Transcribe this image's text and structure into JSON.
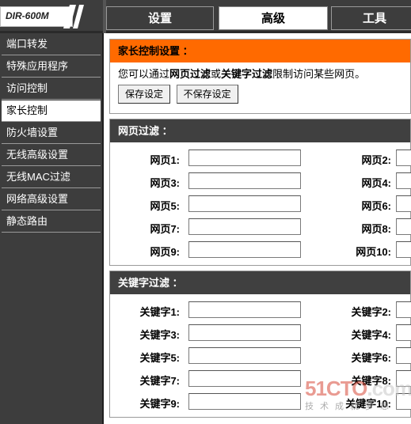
{
  "header": {
    "logo_text": "DIR-600M",
    "tabs": [
      {
        "label": "设置"
      },
      {
        "label": "高级"
      },
      {
        "label": "工具"
      }
    ]
  },
  "sidebar": {
    "items": [
      {
        "label": "端口转发"
      },
      {
        "label": "特殊应用程序"
      },
      {
        "label": "访问控制"
      },
      {
        "label": "家长控制"
      },
      {
        "label": "防火墙设置"
      },
      {
        "label": "无线高级设置"
      },
      {
        "label": "无线MAC过滤"
      },
      {
        "label": "网络高级设置"
      },
      {
        "label": "静态路由"
      }
    ]
  },
  "parental": {
    "title": "家长控制设置 ：",
    "intro_prefix": "您可以通过",
    "intro_bold1": "网页过滤",
    "intro_mid": "或",
    "intro_bold2": "关键字过滤",
    "intro_suffix": "限制访问某些网页。",
    "save_label": "保存设定",
    "nosave_label": "不保存设定"
  },
  "web_filter": {
    "title": "网页过滤 ：",
    "left": [
      {
        "label": "网页1:",
        "value": ""
      },
      {
        "label": "网页3:",
        "value": ""
      },
      {
        "label": "网页5:",
        "value": ""
      },
      {
        "label": "网页7:",
        "value": ""
      },
      {
        "label": "网页9:",
        "value": ""
      }
    ],
    "right": [
      {
        "label": "网页2:",
        "value": ""
      },
      {
        "label": "网页4:",
        "value": ""
      },
      {
        "label": "网页6:",
        "value": ""
      },
      {
        "label": "网页8:",
        "value": ""
      },
      {
        "label": "网页10:",
        "value": ""
      }
    ]
  },
  "keyword_filter": {
    "title": "关键字过滤 ：",
    "left": [
      {
        "label": "关键字1:",
        "value": ""
      },
      {
        "label": "关键字3:",
        "value": ""
      },
      {
        "label": "关键字5:",
        "value": ""
      },
      {
        "label": "关键字7:",
        "value": ""
      },
      {
        "label": "关键字9:",
        "value": ""
      }
    ],
    "right": [
      {
        "label": "关键字2:",
        "value": ""
      },
      {
        "label": "关键字4:",
        "value": ""
      },
      {
        "label": "关键字6:",
        "value": ""
      },
      {
        "label": "关键字8:",
        "value": ""
      },
      {
        "label": "关键字10:",
        "value": ""
      }
    ]
  },
  "watermark": {
    "logo_a": "51CTO",
    "logo_b": ".com",
    "slogan": "技术成就梦想"
  },
  "colors": {
    "accent_orange": "#ff6a00",
    "dark_bar": "#404040",
    "sidebar_bg": "#3d3d3d"
  }
}
